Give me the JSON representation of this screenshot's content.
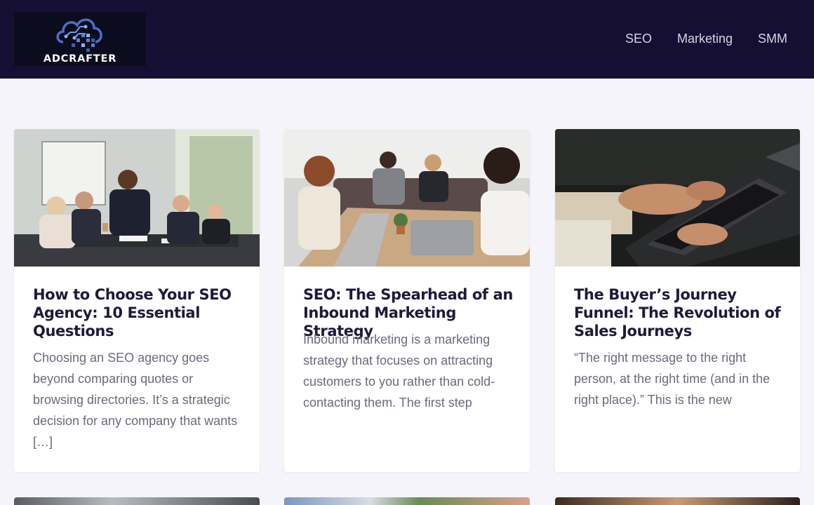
{
  "header": {
    "logo_text": "ADCRAFTER",
    "nav": [
      {
        "label": "SEO"
      },
      {
        "label": "Marketing"
      },
      {
        "label": "SMM"
      }
    ]
  },
  "posts": [
    {
      "title": "How to Choose Your SEO Agency: 10 Essential Questions",
      "excerpt": "Choosing an SEO agency goes beyond comparing quotes or browsing directories. It’s a strategic decision for any company that wants […]",
      "image": "team-meeting-photo"
    },
    {
      "title": "SEO: The Spearhead of an Inbound Marketing Strategy",
      "excerpt": "Inbound marketing is a marketing strategy that focuses on attracting customers to you rather than cold-contacting them. The first step",
      "image": "office-discussion-photo"
    },
    {
      "title": "The Buyer’s Journey Funnel: The Revolution of Sales Journeys",
      "excerpt": "“The right message to the right person, at the right time (and in the right place).” This is the new",
      "image": "laptop-typing-photo"
    }
  ],
  "colors": {
    "header_bg": "#150f33",
    "page_bg": "#f5f4fb",
    "title": "#1f1a3a",
    "excerpt": "#6b6a7c",
    "nav": "#d6d4e6"
  }
}
